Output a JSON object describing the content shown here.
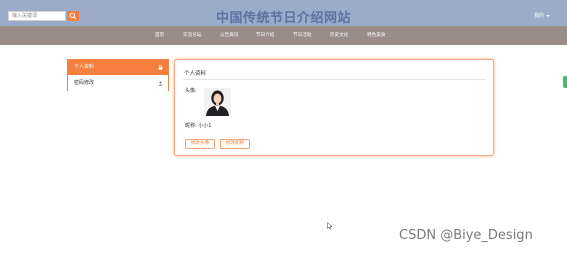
{
  "header": {
    "search_placeholder": "输入关键词",
    "site_title": "中国传统节日介绍网站",
    "user_label": "我的"
  },
  "nav": {
    "items": [
      "首页",
      "交流论坛",
      "公告资讯",
      "节日介绍",
      "节日活动",
      "历史文化",
      "特色美食"
    ]
  },
  "sidebar": {
    "items": [
      {
        "label": "个人资料",
        "icon": "lock-icon",
        "active": true
      },
      {
        "label": "密码修改",
        "icon": "person-icon",
        "active": false
      }
    ]
  },
  "profile": {
    "title": "个人资料",
    "avatar_label": "头像:",
    "nickname_label": "昵称:",
    "nickname_value": "小小1",
    "upload_button": "修改头像",
    "save_button": "修改昵称"
  },
  "watermark": "CSDN @Biye_Design",
  "colors": {
    "topbar": "#9aacca",
    "navbar": "#9a8d88",
    "accent": "#f5803e",
    "title": "#5d72a0"
  }
}
